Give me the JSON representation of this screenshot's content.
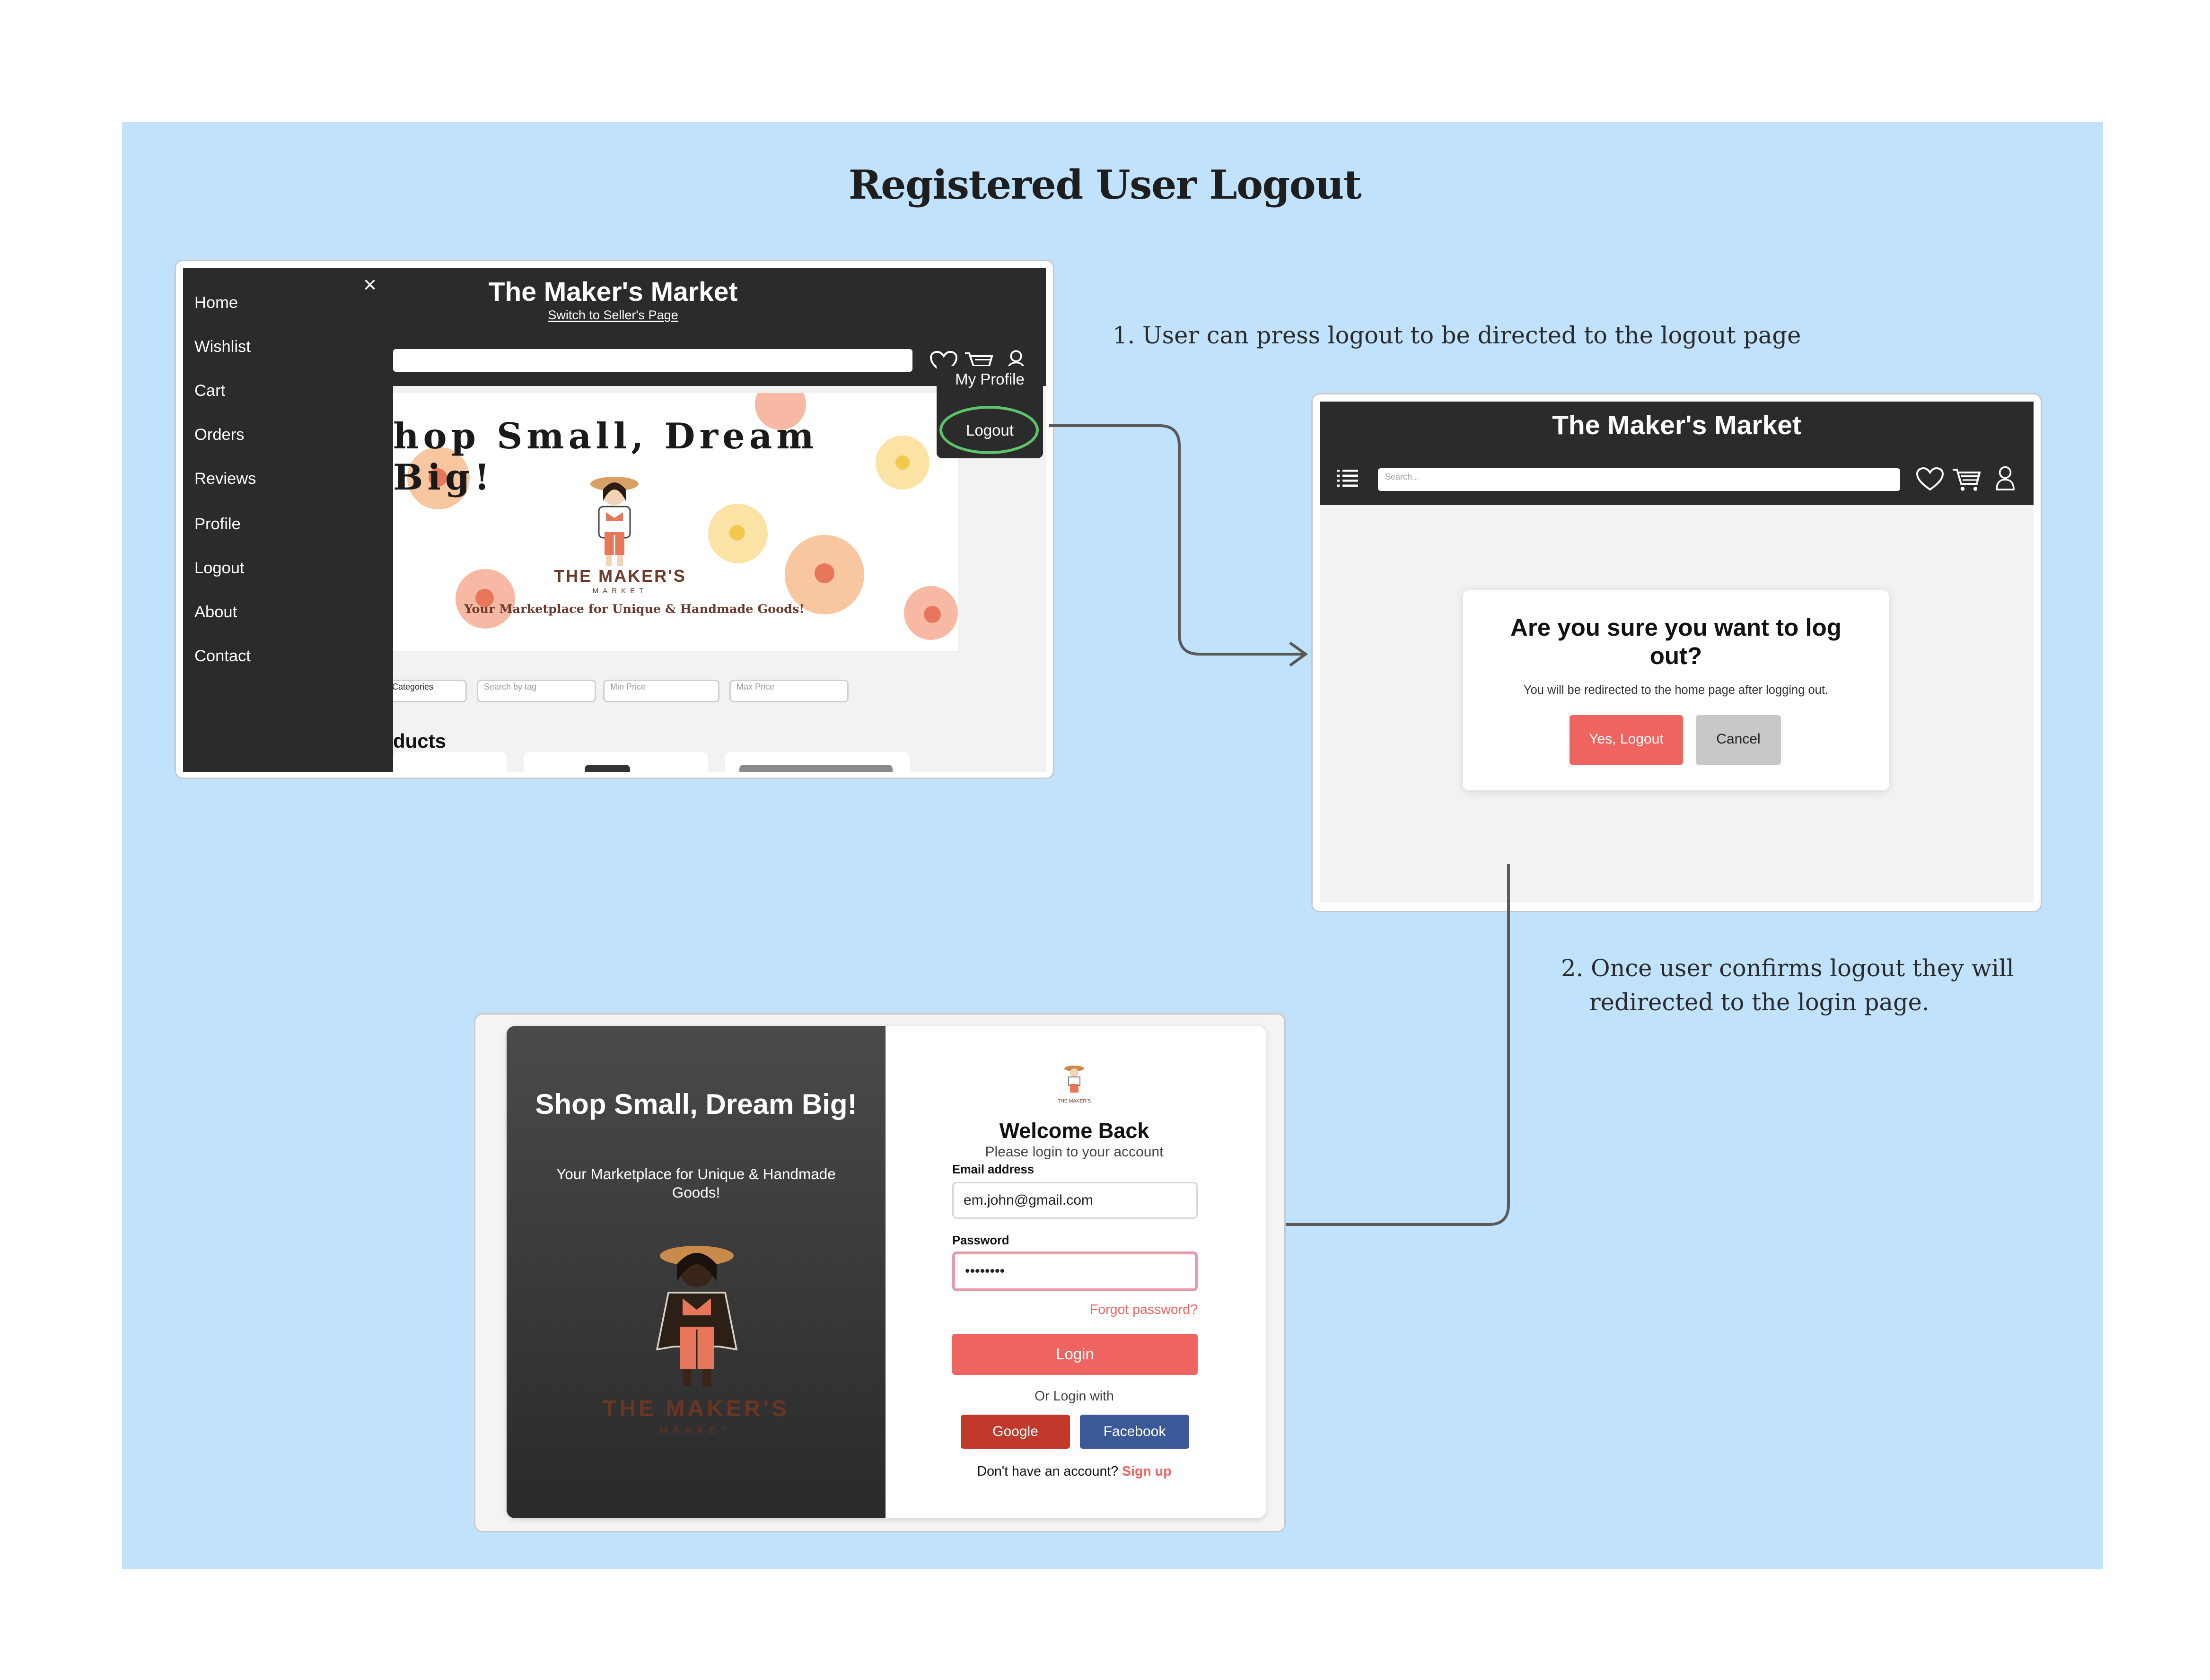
{
  "diagram": {
    "title": "Registered User Logout",
    "step1": "1. User can press logout to be directed to the logout page",
    "step2_line1": "2. Once user confirms logout they will",
    "step2_line2": "redirected to the login page."
  },
  "screen1": {
    "menu_items": [
      "Home",
      "Wishlist",
      "Cart",
      "Orders",
      "Reviews",
      "Profile",
      "Logout",
      "About",
      "Contact"
    ],
    "close_symbol": "×",
    "site_title": "The Maker's Market",
    "switch_link": "Switch to Seller's Page",
    "dropdown_my_profile": "My Profile",
    "dropdown_logout": "Logout",
    "banner_headline": "hop Small, Dream Big!",
    "banner_brand": "THE MAKER'S",
    "banner_brand_sub": "MARKET",
    "banner_tagline": "Your Marketplace for Unique & Handmade Goods!",
    "filter_categories": "ll Categories",
    "filter_tag_placeholder": "Search by tag",
    "filter_min_placeholder": "Min Price",
    "filter_max_placeholder": "Max Price",
    "products_heading": "ducts"
  },
  "screen2": {
    "site_title": "The Maker's Market",
    "search_placeholder": "Search...",
    "dialog_title": "Are you sure you want to log out?",
    "dialog_text": "You will be redirected to the home page after logging out.",
    "confirm_label": "Yes, Logout",
    "cancel_label": "Cancel"
  },
  "screen3": {
    "hero_title": "Shop Small, Dream Big!",
    "hero_subtitle": "Your Marketplace for Unique & Handmade Goods!",
    "hero_brand": "THE MAKER'S",
    "hero_brand_sub": "MARKET",
    "logo_caption": "THE MAKER'S",
    "welcome": "Welcome Back",
    "welcome_sub": "Please login to your account",
    "email_label": "Email address",
    "email_value": "em.john@gmail.com",
    "password_label": "Password",
    "password_value": "••••••••",
    "forgot": "Forgot password?",
    "login_label": "Login",
    "or_login_with": "Or Login with",
    "google_label": "Google",
    "facebook_label": "Facebook",
    "no_account": "Don't have an account?",
    "signup": "Sign up"
  },
  "colors": {
    "board": "#c1e2fd",
    "dark": "#2b2b2b",
    "accent_red": "#ef6461",
    "highlight_green": "#5ec46b",
    "google": "#c0392b",
    "facebook": "#3b5998"
  }
}
